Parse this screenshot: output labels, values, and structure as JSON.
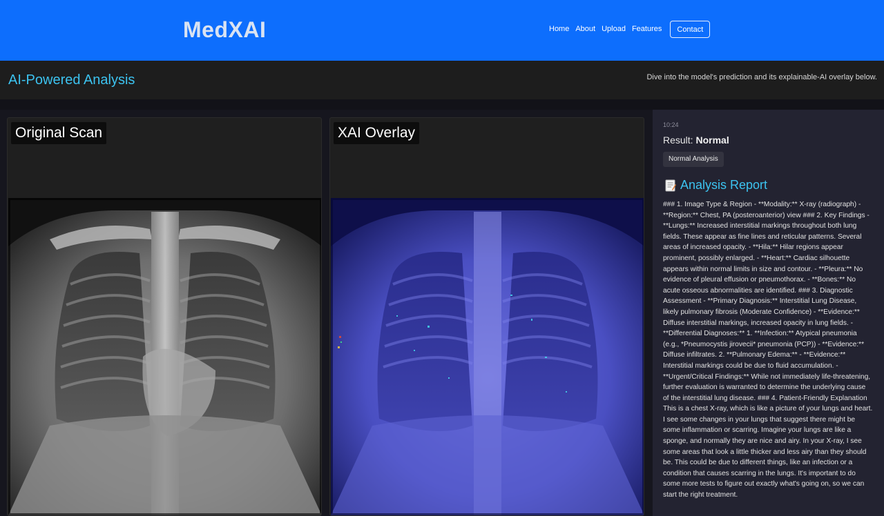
{
  "header": {
    "brand": "MedXAI",
    "nav": [
      "Home",
      "About",
      "Upload",
      "Features"
    ],
    "contact": "Contact"
  },
  "subheader": {
    "title": "AI-Powered Analysis",
    "tagline": "Dive into the model's prediction and its explainable-AI overlay below."
  },
  "panels": {
    "original": "Original Scan",
    "overlay": "XAI Overlay"
  },
  "sidebar": {
    "time": "10:24",
    "result_label": "Result:",
    "result_value": "Normal",
    "badge": "Normal Analysis",
    "report_title": "Analysis Report",
    "report_text": "### 1. Image Type & Region - **Modality:** X-ray (radiograph) - **Region:** Chest, PA (posteroanterior) view ### 2. Key Findings - **Lungs:** Increased interstitial markings throughout both lung fields. These appear as fine lines and reticular patterns. Several areas of increased opacity. - **Hila:** Hilar regions appear prominent, possibly enlarged. - **Heart:** Cardiac silhouette appears within normal limits in size and contour. - **Pleura:** No evidence of pleural effusion or pneumothorax. - **Bones:** No acute osseous abnormalities are identified. ### 3. Diagnostic Assessment - **Primary Diagnosis:** Interstitial Lung Disease, likely pulmonary fibrosis (Moderate Confidence) - **Evidence:** Diffuse interstitial markings, increased opacity in lung fields. - **Differential Diagnoses:** 1. **Infection:** Atypical pneumonia (e.g., *Pneumocystis jirovecii* pneumonia (PCP)) - **Evidence:** Diffuse infiltrates. 2. **Pulmonary Edema:** - **Evidence:** Interstitial markings could be due to fluid accumulation. - **Urgent/Critical Findings:** While not immediately life-threatening, further evaluation is warranted to determine the underlying cause of the interstitial lung disease. ### 4. Patient-Friendly Explanation This is a chest X-ray, which is like a picture of your lungs and heart. I see some changes in your lungs that suggest there might be some inflammation or scarring. Imagine your lungs are like a sponge, and normally they are nice and airy. In your X-ray, I see some areas that look a little thicker and less airy than they should be. This could be due to different things, like an infection or a condition that causes scarring in the lungs. It's important to do some more tests to figure out exactly what's going on, so we can start the right treatment."
  },
  "colors": {
    "header_bg": "#0d6efd",
    "accent": "#3cc3f0",
    "overlay_tint": "#3a3fd0"
  }
}
